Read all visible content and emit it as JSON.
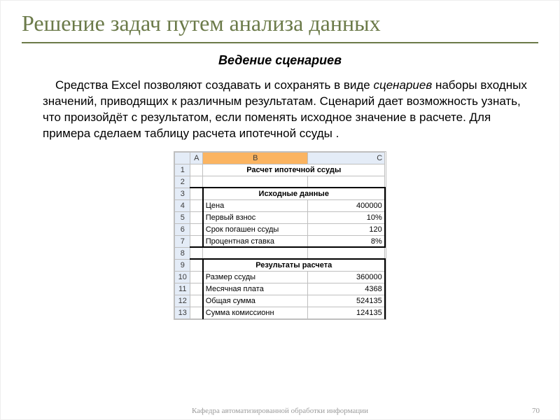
{
  "title": "Решение задач путем анализа данных",
  "subtitle": "Ведение сценариев",
  "para_prefix": "Средства Excel позволяют создавать и сохранять в виде ",
  "para_italic": "сценариев",
  "para_suffix": " наборы входных значений, приводящих к различным результатам. Сценарий дает возможность узнать, что произойдёт с результатом, если поменять исходное значение в расчете. Для примера сделаем таблицу расчета ипотечной ссуды .",
  "excel": {
    "cols": [
      "",
      "A",
      "B",
      "C"
    ],
    "row1_title": "Расчет ипотечной ссуды",
    "row3_title": "Исходные данные",
    "r4_label": "Цена",
    "r4_val": "400000",
    "r5_label": "Первый взнос",
    "r5_val": "10%",
    "r6_label": "Срок погашен ссуды",
    "r6_val": "120",
    "r7_label": "Процентная ставка",
    "r7_val": "8%",
    "row9_title": "Результаты расчета",
    "r10_label": "Размер ссуды",
    "r10_val": "360000",
    "r11_label": "Месячная плата",
    "r11_val": "4368",
    "r12_label": "Общая сумма",
    "r12_val": "524135",
    "r13_label": "Сумма  комиссионн",
    "r13_val": "124135"
  },
  "footer": "Кафедра автоматизированной обработки информации",
  "pagenum": "70"
}
